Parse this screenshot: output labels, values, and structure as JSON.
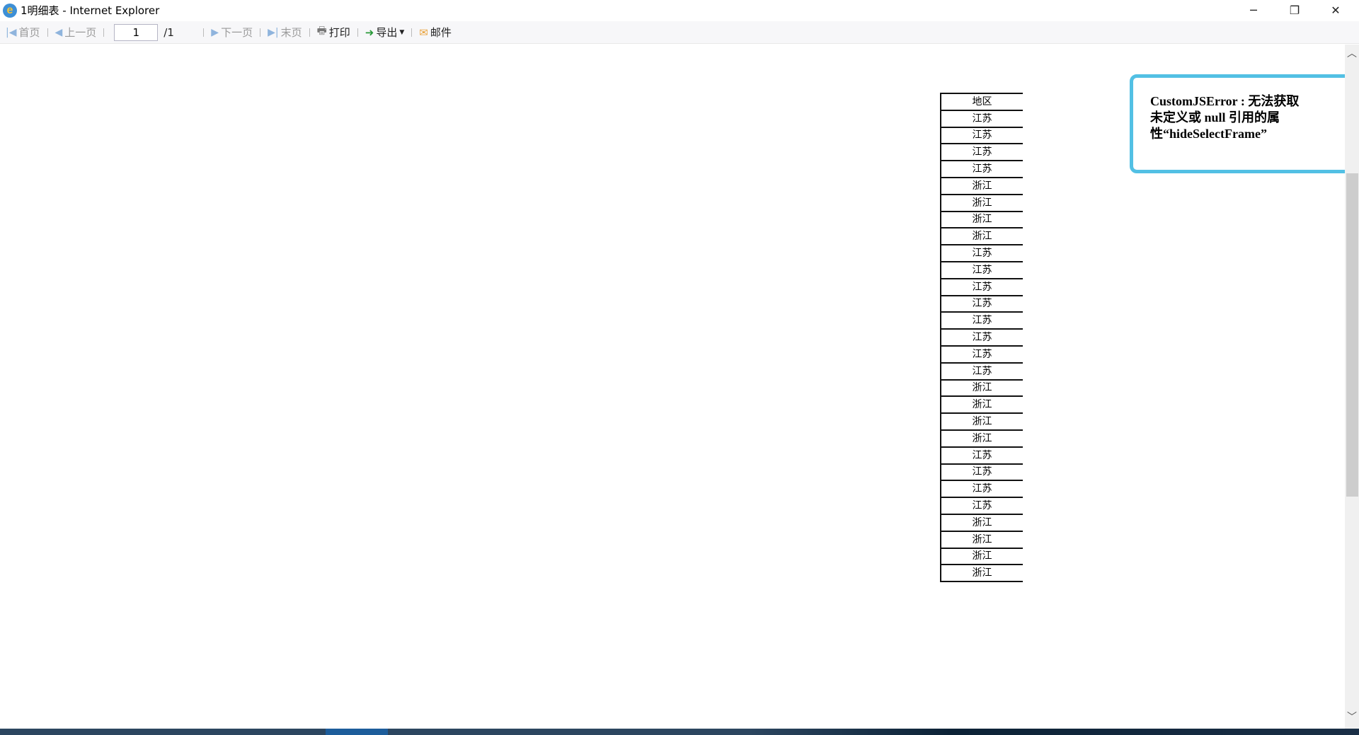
{
  "window": {
    "title": "1明细表 - Internet Explorer",
    "minimize": "─",
    "restore": "❐",
    "close": "✕"
  },
  "toolbar": {
    "first": "首页",
    "prev": "上一页",
    "page_value": "1",
    "page_total": "/1",
    "next": "下一页",
    "last": "末页",
    "print": "打印",
    "export": "导出",
    "mail": "邮件"
  },
  "table": {
    "header": "地区",
    "rows": [
      "江苏",
      "江苏",
      "江苏",
      "江苏",
      "浙江",
      "浙江",
      "浙江",
      "浙江",
      "江苏",
      "江苏",
      "江苏",
      "江苏",
      "江苏",
      "江苏",
      "江苏",
      "江苏",
      "浙江",
      "浙江",
      "浙江",
      "浙江",
      "江苏",
      "江苏",
      "江苏",
      "江苏",
      "浙江",
      "浙江",
      "浙江",
      "浙江"
    ]
  },
  "error": {
    "message": "CustomJSError : 无法获取未定义或 null 引用的属性“hideSelectFrame”"
  },
  "colors": {
    "error_border": "#52c0e4"
  }
}
